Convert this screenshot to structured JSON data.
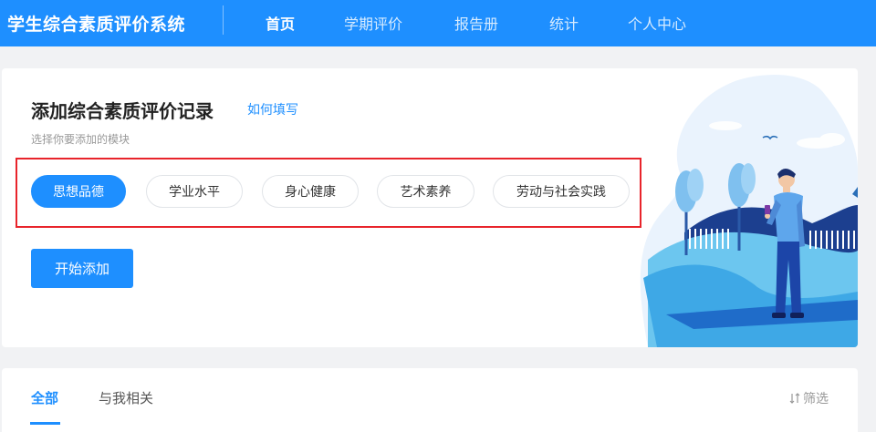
{
  "app": {
    "title": "学生综合素质评价系统"
  },
  "nav": {
    "items": [
      {
        "label": "首页",
        "active": true
      },
      {
        "label": "学期评价",
        "active": false
      },
      {
        "label": "报告册",
        "active": false
      },
      {
        "label": "统计",
        "active": false
      },
      {
        "label": "个人中心",
        "active": false
      }
    ]
  },
  "add_record": {
    "title": "添加综合素质评价记录",
    "help_link": "如何填写",
    "subtitle": "选择你要添加的模块",
    "modules": [
      {
        "label": "思想品德",
        "selected": true
      },
      {
        "label": "学业水平",
        "selected": false
      },
      {
        "label": "身心健康",
        "selected": false
      },
      {
        "label": "艺术素养",
        "selected": false
      },
      {
        "label": "劳动与社会实践",
        "selected": false
      }
    ],
    "start_button": "开始添加"
  },
  "records": {
    "tabs": [
      {
        "label": "全部",
        "active": true
      },
      {
        "label": "与我相关",
        "active": false
      }
    ],
    "filter_label": "筛选",
    "filter_icon": "sort-icon"
  },
  "colors": {
    "primary": "#1e8fff",
    "highlight_border": "#e8242b"
  }
}
